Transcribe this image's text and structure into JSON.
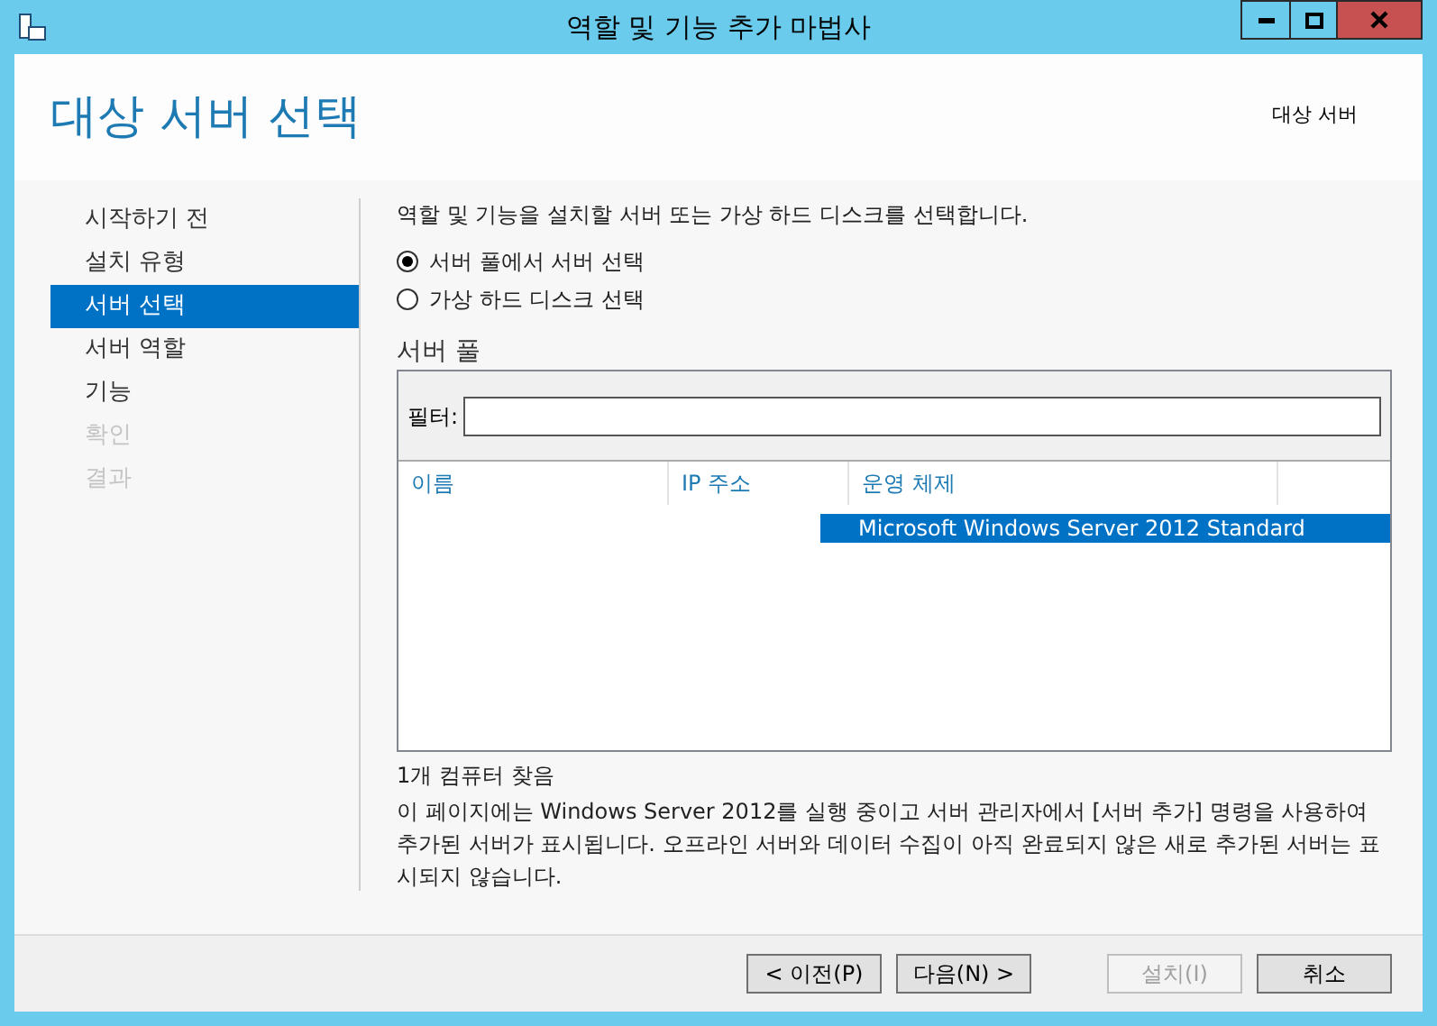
{
  "window": {
    "title": "역할 및 기능 추가 마법사"
  },
  "header": {
    "title": "대상 서버 선택",
    "destination_label": "대상 서버"
  },
  "nav": [
    {
      "label": "시작하기 전",
      "selected": false,
      "disabled": false
    },
    {
      "label": "설치 유형",
      "selected": false,
      "disabled": false
    },
    {
      "label": "서버 선택",
      "selected": true,
      "disabled": false
    },
    {
      "label": "서버 역할",
      "selected": false,
      "disabled": false
    },
    {
      "label": "기능",
      "selected": false,
      "disabled": false
    },
    {
      "label": "확인",
      "selected": false,
      "disabled": true
    },
    {
      "label": "결과",
      "selected": false,
      "disabled": true
    }
  ],
  "intro": "역할 및 기능을 설치할 서버 또는 가상 하드 디스크를 선택합니다.",
  "options": [
    {
      "label": "서버 풀에서 서버 선택",
      "selected": true
    },
    {
      "label": "가상 하드 디스크 선택",
      "selected": false
    }
  ],
  "server_pool": {
    "title": "서버 풀",
    "filter_label": "필터:",
    "columns": [
      "이름",
      "IP 주소",
      "운영 체제"
    ],
    "rows": [
      {
        "os": "Microsoft Windows Server 2012 Standard",
        "selected": true
      }
    ],
    "count": "1개 컴퓨터 찾음"
  },
  "note": "이 페이지에는 Windows Server 2012를 실행 중이고 서버 관리자에서 [서버 추가] 명령을 사용하여 추가된 서버가 표시됩니다. 오프라인 서버와 데이터 수집이 아직 완료되지 않은 새로 추가된 서버는 표시되지 않습니다.",
  "buttons": [
    {
      "label": "< 이전(P)",
      "disabled": false
    },
    {
      "label": "다음(N) >",
      "disabled": false
    },
    {
      "label": "설치(I)",
      "disabled": true
    },
    {
      "label": "취소",
      "disabled": false
    }
  ]
}
